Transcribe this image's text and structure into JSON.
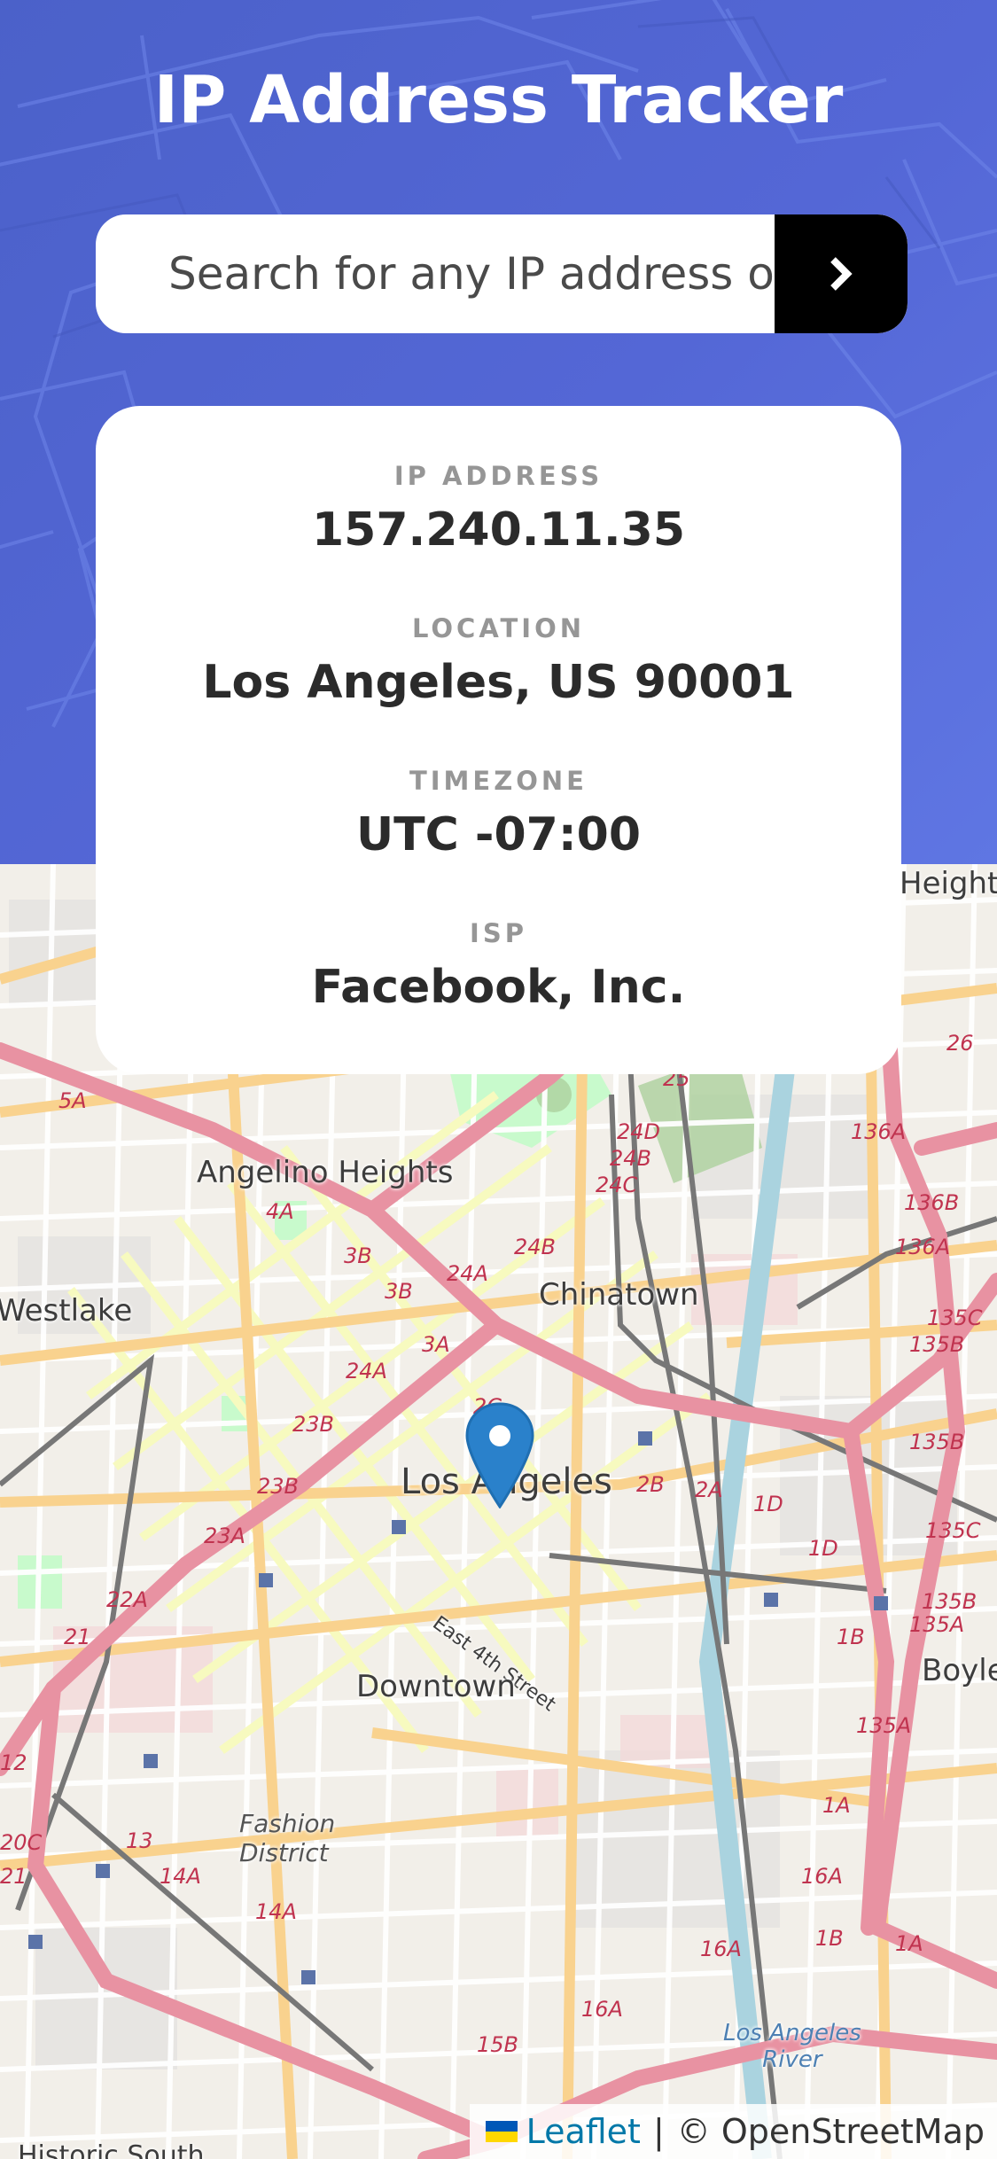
{
  "app": {
    "title": "IP Address Tracker"
  },
  "search": {
    "placeholder": "Search for any IP address or domain",
    "submit_icon": "chevron-right-icon"
  },
  "info": {
    "ip_label": "IP ADDRESS",
    "ip_value": "157.240.11.35",
    "location_label": "LOCATION",
    "location_value": "Los Angeles, US 90001",
    "timezone_label": "TIMEZONE",
    "timezone_value": "UTC -07:00",
    "isp_label": "ISP",
    "isp_value": "Facebook, Inc."
  },
  "map": {
    "marker_icon": "map-pin-icon",
    "labels": {
      "angelino_heights": "Angelino Heights",
      "chinatown": "Chinatown",
      "westlake": "Westlake",
      "los_angeles": "Los Angeles",
      "downtown": "Downtown",
      "fashion_district": "Fashion\nDistrict",
      "east_4th_street": "East 4th Street",
      "boyle": "Boyle",
      "heights": "Heights",
      "la_river": "Los Angeles\nRiver",
      "historic_south": "Historic South"
    },
    "route_shields": [
      "5A",
      "4A",
      "3B",
      "24A",
      "24B",
      "24D",
      "24C",
      "25",
      "3A",
      "2C",
      "23B",
      "23A",
      "22A",
      "21",
      "2B",
      "2A",
      "1D",
      "136A",
      "136B",
      "135C",
      "135B",
      "135A",
      "135C",
      "1B",
      "1A",
      "16A",
      "12",
      "20C",
      "13",
      "14A",
      "15B",
      "26"
    ],
    "attribution": {
      "leaflet": "Leaflet",
      "separator": "|",
      "osm": "© OpenStreetMap"
    }
  },
  "colors": {
    "header_bg": "#5066d3",
    "motorway": "#e892a2",
    "primary_road": "#f9d28e",
    "secondary_road": "#f7fabf",
    "rail": "#777777",
    "water": "#aad3df",
    "marker": "#2a81cb"
  }
}
